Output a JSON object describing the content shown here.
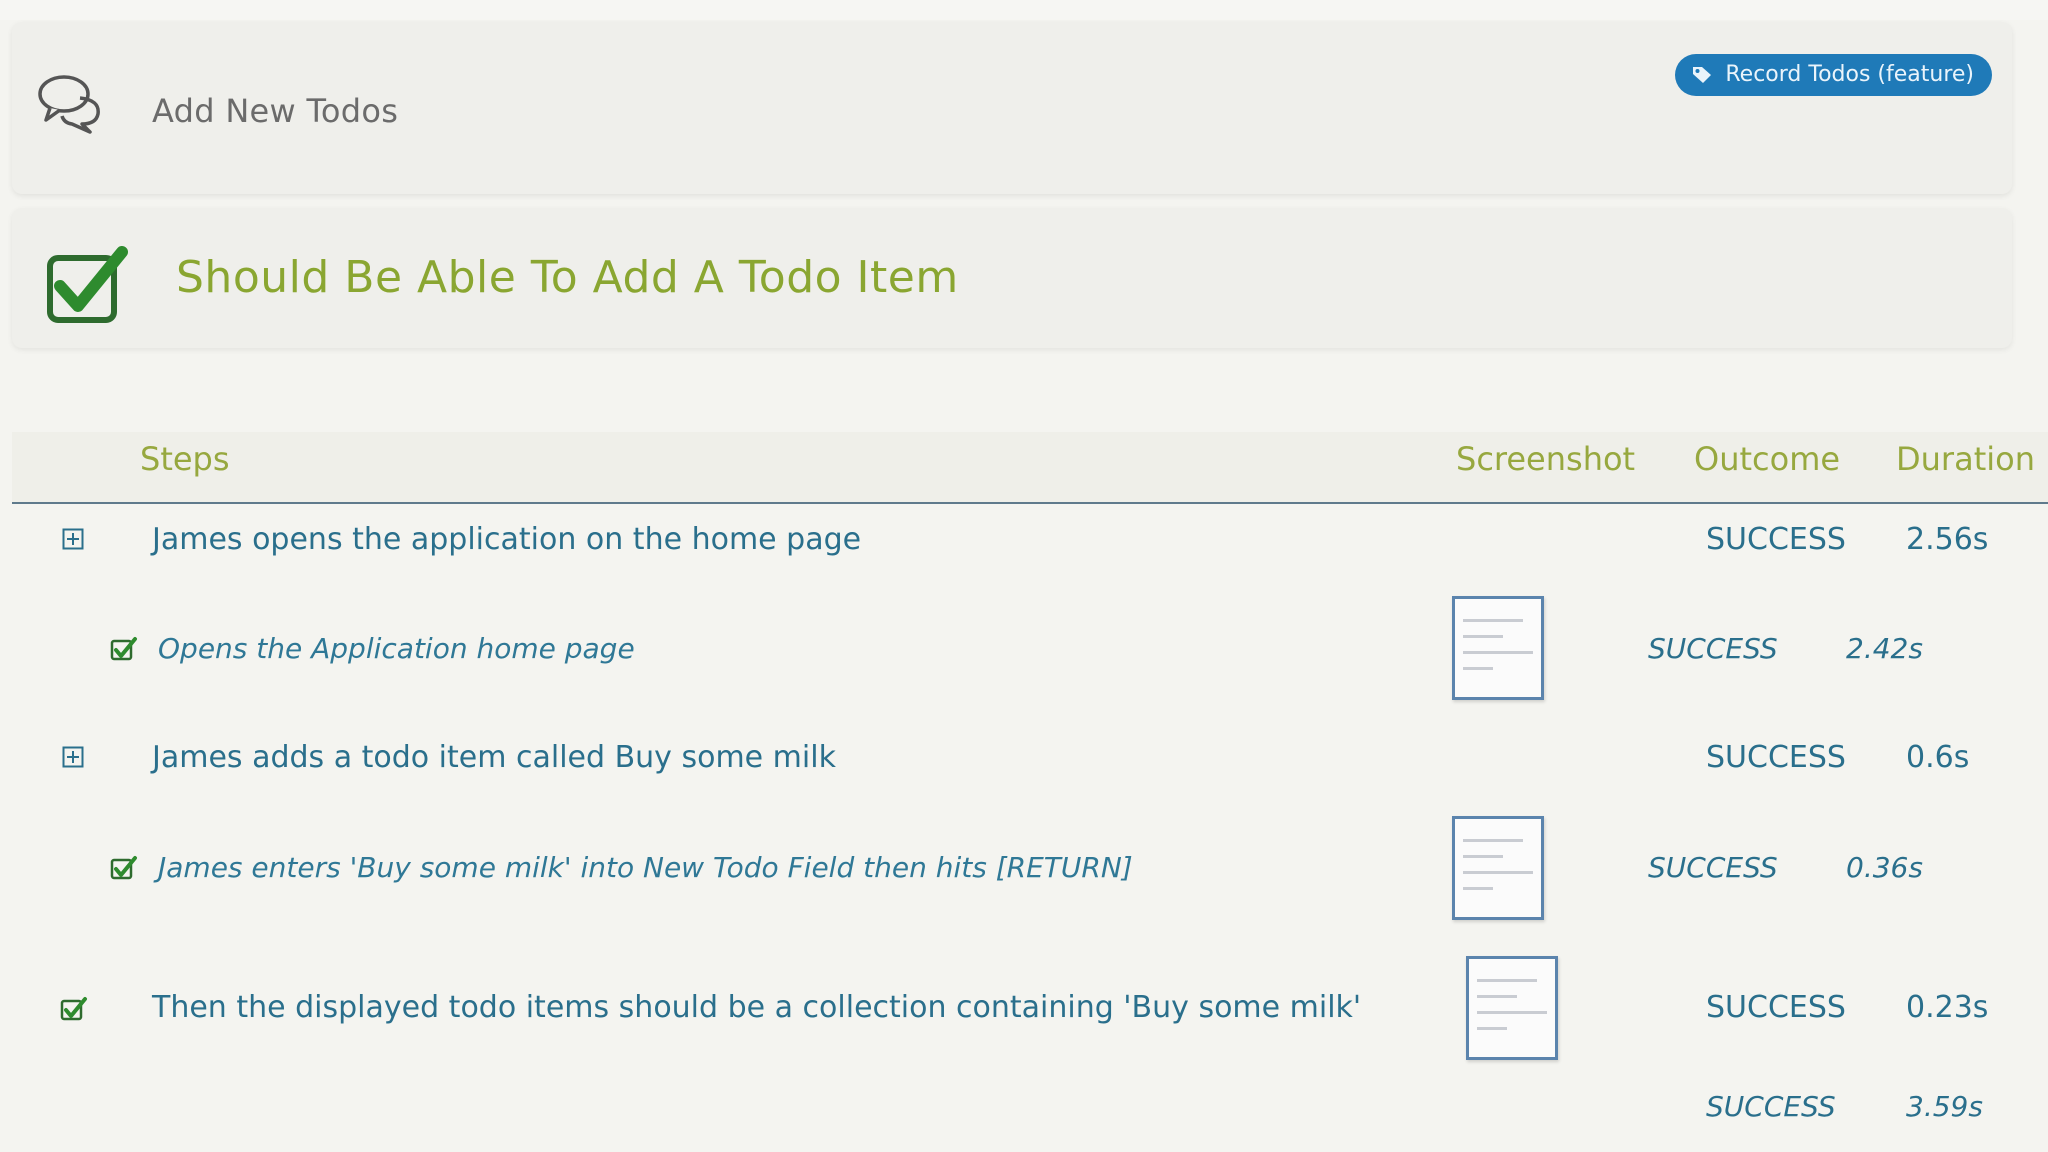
{
  "story": {
    "title": "Add New Todos",
    "tag_label": "Record Todos (feature)"
  },
  "scenario": {
    "title": "Should Be Able To Add A Todo Item",
    "status_color": "#2e8b2e"
  },
  "table": {
    "headers": {
      "steps": "Steps",
      "screenshot": "Screenshot",
      "outcome": "Outcome",
      "duration": "Duration"
    },
    "rows": [
      {
        "icon": "expand-icon",
        "text": "James opens the application on the home page",
        "has_screenshot": false,
        "outcome": "SUCCESS",
        "duration": "2.56s"
      },
      {
        "icon": "check-icon",
        "text": "Opens the Application home page",
        "has_screenshot": true,
        "outcome": "SUCCESS",
        "duration": "2.42s"
      },
      {
        "icon": "expand-icon",
        "text": "James adds a todo item called Buy some milk",
        "has_screenshot": false,
        "outcome": "SUCCESS",
        "duration": "0.6s"
      },
      {
        "icon": "check-icon",
        "text": "James enters 'Buy some milk' into New Todo Field then hits [RETURN]",
        "has_screenshot": true,
        "outcome": "SUCCESS",
        "duration": "0.36s"
      },
      {
        "icon": "check-icon",
        "text": "Then the displayed todo items should be a collection containing 'Buy some milk'",
        "has_screenshot": true,
        "outcome": "SUCCESS",
        "duration": "0.23s"
      }
    ],
    "total": {
      "outcome": "SUCCESS",
      "duration": "3.59s"
    }
  },
  "colors": {
    "accent_tag": "#1f7ab8",
    "header_text": "#97a83f",
    "row_text": "#2a6f8c",
    "scenario_title": "#8aa631"
  }
}
